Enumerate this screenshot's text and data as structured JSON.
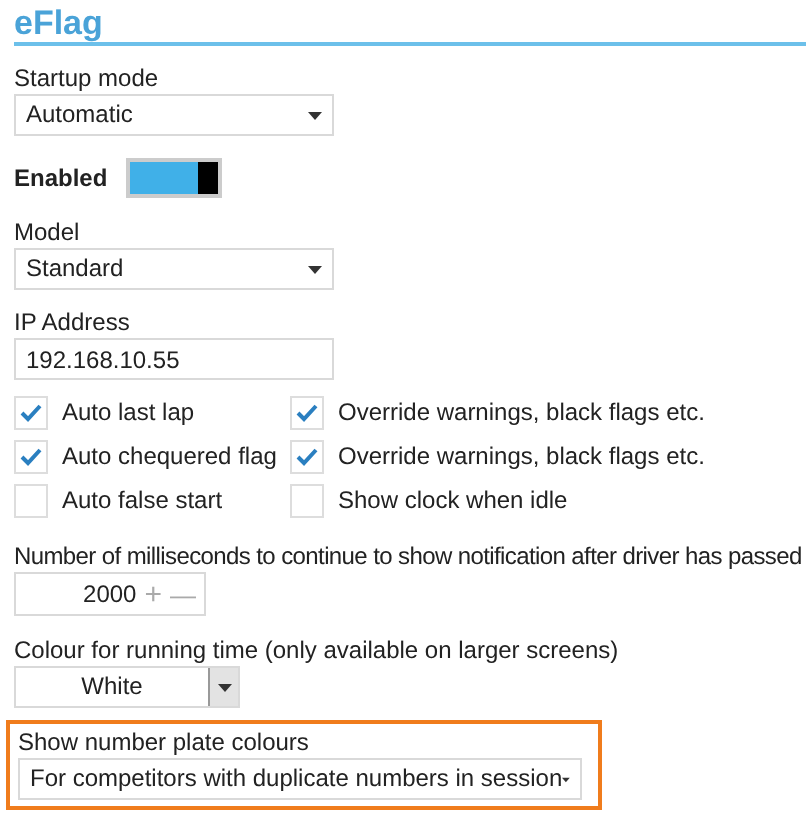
{
  "section_title": "eFlag",
  "startup_mode": {
    "label": "Startup mode",
    "value": "Automatic"
  },
  "enabled": {
    "label": "Enabled",
    "on": true
  },
  "model": {
    "label": "Model",
    "value": "Standard"
  },
  "ip_address": {
    "label": "IP Address",
    "value": "192.168.10.55"
  },
  "checkboxes": [
    {
      "label": "Auto last lap",
      "checked": true
    },
    {
      "label": "Override warnings, black flags etc.",
      "checked": true
    },
    {
      "label": "Auto chequered flag",
      "checked": true
    },
    {
      "label": "Override warnings, black flags etc.",
      "checked": true
    },
    {
      "label": "Auto false start",
      "checked": false
    },
    {
      "label": "Show clock when idle",
      "checked": false
    }
  ],
  "notification_ms": {
    "label": "Number of milliseconds to continue to show notification after driver has passed",
    "value": "2000",
    "increment": "+",
    "decrement": "—"
  },
  "running_time_colour": {
    "label": "Colour for running time (only available on larger screens)",
    "value": "White"
  },
  "number_plate_colours": {
    "label": "Show number plate colours",
    "value": "For competitors with duplicate numbers in session",
    "highlighted": true
  }
}
